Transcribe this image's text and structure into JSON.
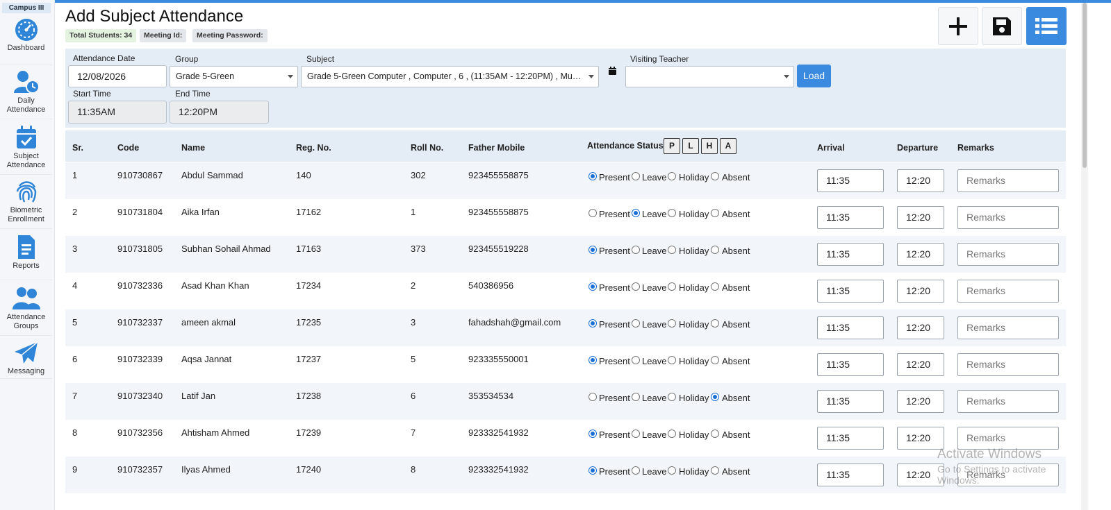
{
  "sidebar": {
    "campus": "Campus III",
    "items": [
      {
        "label": "Dashboard",
        "icon": "dashboard-gauge-icon"
      },
      {
        "label": "Daily Attendance",
        "icon": "user-clock-icon"
      },
      {
        "label": "Subject Attendance",
        "icon": "calendar-check-icon"
      },
      {
        "label": "Biometric Enrollment",
        "icon": "fingerprint-icon"
      },
      {
        "label": "Reports",
        "icon": "report-document-icon"
      },
      {
        "label": "Attendance Groups",
        "icon": "users-group-icon"
      },
      {
        "label": "Messaging",
        "icon": "paper-plane-icon"
      }
    ]
  },
  "header": {
    "title": "Add Subject Attendance",
    "total_students": "Total Students: 34",
    "meeting_id": "Meeting Id:",
    "meeting_password": "Meeting Password:"
  },
  "actions": {
    "add": "plus-icon",
    "save": "floppy-save-icon",
    "list": "list-icon"
  },
  "filters": {
    "attendance_date_label": "Attendance Date",
    "attendance_date": "12/08/2026",
    "group_label": "Group",
    "group": "Grade 5-Green",
    "subject_label": "Subject",
    "subject": "Grade 5-Green Computer , Computer , 6 , (11:35AM - 12:20PM) , Muh...",
    "visiting_teacher_label": "Visiting Teacher",
    "visiting_teacher": "",
    "load": "Load",
    "start_time_label": "Start Time",
    "start_time": "11:35AM",
    "end_time_label": "End Time",
    "end_time": "12:20PM"
  },
  "table": {
    "headers": {
      "sr": "Sr.",
      "code": "Code",
      "name": "Name",
      "reg": "Reg. No.",
      "roll": "Roll No.",
      "mobile": "Father Mobile",
      "status": "Attendance Status",
      "arrival": "Arrival",
      "departure": "Departure",
      "remarks": "Remarks"
    },
    "status_buttons": [
      "P",
      "L",
      "H",
      "A"
    ],
    "status_options": [
      "Present",
      "Leave",
      "Holiday",
      "Absent"
    ],
    "remarks_placeholder": "Remarks",
    "rows": [
      {
        "sr": "1",
        "code": "910730867",
        "name": "Abdul Sammad",
        "reg": "140",
        "roll": "302",
        "mobile": "923455558875",
        "status": "Present",
        "arrival": "11:35",
        "departure": "12:20"
      },
      {
        "sr": "2",
        "code": "910731804",
        "name": "Aika Irfan",
        "reg": "17162",
        "roll": "1",
        "mobile": "923455558875",
        "status": "Leave",
        "arrival": "11:35",
        "departure": "12:20"
      },
      {
        "sr": "3",
        "code": "910731805",
        "name": "Subhan Sohail Ahmad",
        "reg": "17163",
        "roll": "373",
        "mobile": "923455519228",
        "status": "Present",
        "arrival": "11:35",
        "departure": "12:20"
      },
      {
        "sr": "4",
        "code": "910732336",
        "name": "Asad Khan Khan",
        "reg": "17234",
        "roll": "2",
        "mobile": "540386956",
        "status": "Present",
        "arrival": "11:35",
        "departure": "12:20"
      },
      {
        "sr": "5",
        "code": "910732337",
        "name": "ameen akmal",
        "reg": "17235",
        "roll": "3",
        "mobile": "fahadshah@gmail.com",
        "status": "Present",
        "arrival": "11:35",
        "departure": "12:20"
      },
      {
        "sr": "6",
        "code": "910732339",
        "name": "Aqsa Jannat",
        "reg": "17237",
        "roll": "5",
        "mobile": "923335550001",
        "status": "Present",
        "arrival": "11:35",
        "departure": "12:20"
      },
      {
        "sr": "7",
        "code": "910732340",
        "name": "Latif Jan",
        "reg": "17238",
        "roll": "6",
        "mobile": "353534534",
        "status": "Absent",
        "arrival": "11:35",
        "departure": "12:20"
      },
      {
        "sr": "8",
        "code": "910732356",
        "name": "Ahtisham Ahmed",
        "reg": "17239",
        "roll": "7",
        "mobile": "923332541932",
        "status": "Present",
        "arrival": "11:35",
        "departure": "12:20"
      },
      {
        "sr": "9",
        "code": "910732357",
        "name": "Ilyas Ahmed",
        "reg": "17240",
        "roll": "8",
        "mobile": "923332541932",
        "status": "Present",
        "arrival": "11:35",
        "departure": "12:20"
      }
    ]
  },
  "watermark": {
    "line1": "Activate Windows",
    "line2": "Go to Settings to activate Windows."
  },
  "colors": {
    "accent": "#3a8be0",
    "filter_bg": "#e4ecf6",
    "radio_on": "#1a6fd6"
  }
}
